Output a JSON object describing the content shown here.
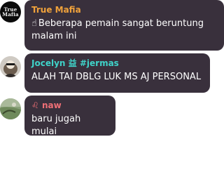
{
  "messages": [
    {
      "author": "True Mafia",
      "author_color": "#f0a23b",
      "avatar_text_line1": "True",
      "avatar_text_line2": "Mafia",
      "icon": "pointing-up-icon",
      "text": "Beberapa pemain sangat beruntung malam ini"
    },
    {
      "author_prefix": "Jocelyn",
      "author_symbol": "益",
      "author_suffix": "#jermas",
      "author_color": "#3fd3c9",
      "text": "ALAH TAI DBLG LUK MS AJ PERSONAL"
    },
    {
      "author_symbol": "♌",
      "author": "naw",
      "author_color": "#ef6f76",
      "text": "baru jugah mulai"
    }
  ],
  "colors": {
    "bubble": "#39303c",
    "text": "#ffffff",
    "background": "#ffffff"
  }
}
